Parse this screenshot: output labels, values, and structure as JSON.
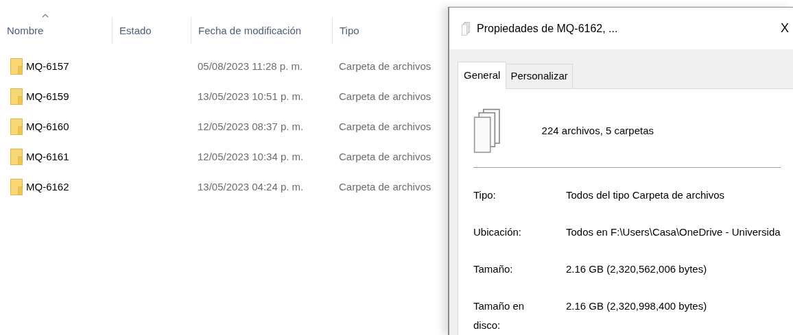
{
  "explorer": {
    "columns": [
      {
        "label": "Nombre",
        "sorted": true
      },
      {
        "label": "Estado",
        "sorted": false
      },
      {
        "label": "Fecha de modificación",
        "sorted": false
      },
      {
        "label": "Tipo",
        "sorted": false
      }
    ],
    "rows": [
      {
        "name": "MQ-6157",
        "date": "05/08/2023 11:28 p. m.",
        "type": "Carpeta de archivos"
      },
      {
        "name": "MQ-6159",
        "date": "13/05/2023 10:51 p. m.",
        "type": "Carpeta de archivos"
      },
      {
        "name": "MQ-6160",
        "date": "12/05/2023 08:37 p. m.",
        "type": "Carpeta de archivos"
      },
      {
        "name": "MQ-6161",
        "date": "12/05/2023 10:34 p. m.",
        "type": "Carpeta de archivos"
      },
      {
        "name": "MQ-6162",
        "date": "13/05/2023 04:24 p. m.",
        "type": "Carpeta de archivos"
      }
    ]
  },
  "dialog": {
    "title": "Propiedades de MQ-6162, ...",
    "close": "X",
    "tabs": [
      {
        "label": "General",
        "selected": true
      },
      {
        "label": "Personalizar",
        "selected": false
      }
    ],
    "summary": "224 archivos, 5 carpetas",
    "properties": [
      {
        "label": "Tipo:",
        "value": "Todos del tipo Carpeta de archivos"
      },
      {
        "label": "Ubicación:",
        "value": "Todos en F:\\Users\\Casa\\OneDrive - Universida"
      },
      {
        "label": "Tamaño:",
        "value": "2.16 GB (2,320,562,006 bytes)"
      },
      {
        "label": "Tamaño en disco:",
        "value": "2.16 GB (2,320,998,400 bytes)"
      }
    ]
  }
}
